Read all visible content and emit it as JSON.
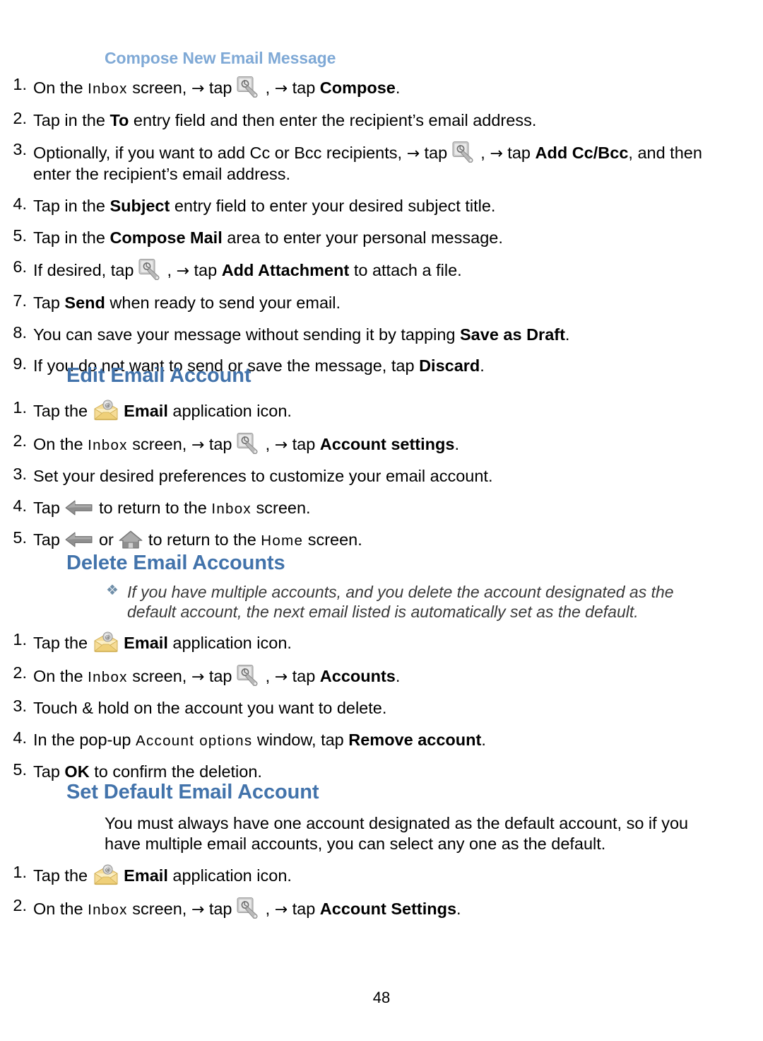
{
  "page": {
    "number": "48"
  },
  "sections": [
    {
      "id": "compose",
      "heading": "Compose New Email Message",
      "heading_level": "sub",
      "steps": [
        {
          "n": "1.",
          "parts": [
            {
              "t": "On the ",
              "s": "plain"
            },
            {
              "t": "Inbox",
              "s": "screen"
            },
            {
              "t": " screen, ",
              "s": "plain"
            },
            {
              "t": "→",
              "s": "arrow"
            },
            {
              "t": " tap ",
              "s": "plain"
            },
            {
              "t": "settings-wrench-icon",
              "s": "icon"
            },
            {
              "t": ", ",
              "s": "plain"
            },
            {
              "t": "→",
              "s": "arrow"
            },
            {
              "t": " tap ",
              "s": "plain"
            },
            {
              "t": "Compose",
              "s": "bold"
            },
            {
              "t": ".",
              "s": "plain"
            }
          ]
        },
        {
          "n": "2.",
          "parts": [
            {
              "t": "Tap in the ",
              "s": "plain"
            },
            {
              "t": "To",
              "s": "bold"
            },
            {
              "t": " entry field and then enter the recipient’s email address.",
              "s": "plain"
            }
          ]
        },
        {
          "n": "3.",
          "parts": [
            {
              "t": "Optionally, if you want to add Cc or Bcc recipients, ",
              "s": "plain"
            },
            {
              "t": "→",
              "s": "arrow"
            },
            {
              "t": " tap ",
              "s": "plain"
            },
            {
              "t": "settings-wrench-icon",
              "s": "icon"
            },
            {
              "t": ", ",
              "s": "plain"
            },
            {
              "t": "→",
              "s": "arrow"
            },
            {
              "t": " tap ",
              "s": "plain"
            },
            {
              "t": "Add Cc/Bcc",
              "s": "bold"
            },
            {
              "t": ", and then enter the recipient’s email address.",
              "s": "plain"
            }
          ]
        },
        {
          "n": "4.",
          "parts": [
            {
              "t": "Tap in the ",
              "s": "plain"
            },
            {
              "t": "Subject",
              "s": "bold"
            },
            {
              "t": " entry field to enter your desired subject title.",
              "s": "plain"
            }
          ]
        },
        {
          "n": "5.",
          "parts": [
            {
              "t": "Tap in the ",
              "s": "plain"
            },
            {
              "t": "Compose Mail",
              "s": "bold"
            },
            {
              "t": " area to enter your personal message.",
              "s": "plain"
            }
          ]
        },
        {
          "n": "6.",
          "parts": [
            {
              "t": "If desired, tap ",
              "s": "plain"
            },
            {
              "t": "settings-wrench-icon",
              "s": "icon"
            },
            {
              "t": ", ",
              "s": "plain"
            },
            {
              "t": "→",
              "s": "arrow"
            },
            {
              "t": " tap ",
              "s": "plain"
            },
            {
              "t": "Add Attachment",
              "s": "bold"
            },
            {
              "t": " to attach a file.",
              "s": "plain"
            }
          ]
        },
        {
          "n": "7.",
          "parts": [
            {
              "t": "Tap ",
              "s": "plain"
            },
            {
              "t": "Send",
              "s": "bold"
            },
            {
              "t": " when ready to send your email.",
              "s": "plain"
            }
          ]
        },
        {
          "n": "8.",
          "parts": [
            {
              "t": "You can save your message without sending it by tapping ",
              "s": "plain"
            },
            {
              "t": "Save as Draft",
              "s": "bold"
            },
            {
              "t": ".",
              "s": "plain"
            }
          ]
        },
        {
          "n": "9.",
          "parts": [
            {
              "t": "If you do not want to send or save the message, tap ",
              "s": "plain"
            },
            {
              "t": "Discard",
              "s": "bold"
            },
            {
              "t": ".",
              "s": "plain"
            }
          ]
        }
      ]
    },
    {
      "id": "edit-email-account",
      "heading": "Edit Email Account",
      "heading_level": "main",
      "steps": [
        {
          "n": "1.",
          "parts": [
            {
              "t": "Tap the ",
              "s": "plain"
            },
            {
              "t": "email-app-icon",
              "s": "icon"
            },
            {
              "t": " ",
              "s": "plain"
            },
            {
              "t": "Email",
              "s": "bold"
            },
            {
              "t": " application icon.",
              "s": "plain"
            }
          ]
        },
        {
          "n": "2.",
          "parts": [
            {
              "t": "On the ",
              "s": "plain"
            },
            {
              "t": "Inbox",
              "s": "screen"
            },
            {
              "t": " screen, ",
              "s": "plain"
            },
            {
              "t": "→",
              "s": "arrow"
            },
            {
              "t": " tap ",
              "s": "plain"
            },
            {
              "t": "settings-wrench-icon",
              "s": "icon"
            },
            {
              "t": ", ",
              "s": "plain"
            },
            {
              "t": "→",
              "s": "arrow"
            },
            {
              "t": " tap ",
              "s": "plain"
            },
            {
              "t": "Account settings",
              "s": "bold"
            },
            {
              "t": ".",
              "s": "plain"
            }
          ]
        },
        {
          "n": "3.",
          "parts": [
            {
              "t": "Set your desired preferences to customize your email account.",
              "s": "plain"
            }
          ]
        },
        {
          "n": "4.",
          "parts": [
            {
              "t": "Tap ",
              "s": "plain"
            },
            {
              "t": "back-arrow-icon",
              "s": "icon"
            },
            {
              "t": " to return to the ",
              "s": "plain"
            },
            {
              "t": "Inbox",
              "s": "screen"
            },
            {
              "t": " screen.",
              "s": "plain"
            }
          ]
        },
        {
          "n": "5.",
          "parts": [
            {
              "t": "Tap ",
              "s": "plain"
            },
            {
              "t": "back-arrow-icon",
              "s": "icon"
            },
            {
              "t": " or ",
              "s": "plain"
            },
            {
              "t": "home-icon",
              "s": "icon"
            },
            {
              "t": " to return to the ",
              "s": "plain"
            },
            {
              "t": "Home",
              "s": "screen"
            },
            {
              "t": " screen.",
              "s": "plain"
            }
          ]
        }
      ]
    },
    {
      "id": "delete-email-accounts",
      "heading": "Delete Email Accounts",
      "heading_level": "main",
      "note": "If you have multiple accounts, and you delete the account designated as the default account, the next email listed is automatically set as the default.",
      "note_bullet": "diamond-bullet-icon",
      "steps": [
        {
          "n": "1.",
          "parts": [
            {
              "t": "Tap the ",
              "s": "plain"
            },
            {
              "t": "email-app-icon",
              "s": "icon"
            },
            {
              "t": " ",
              "s": "plain"
            },
            {
              "t": "Email",
              "s": "bold"
            },
            {
              "t": " application icon.",
              "s": "plain"
            }
          ]
        },
        {
          "n": "2.",
          "parts": [
            {
              "t": "On the ",
              "s": "plain"
            },
            {
              "t": "Inbox",
              "s": "screen"
            },
            {
              "t": " screen, ",
              "s": "plain"
            },
            {
              "t": "→",
              "s": "arrow"
            },
            {
              "t": " tap ",
              "s": "plain"
            },
            {
              "t": "settings-wrench-icon",
              "s": "icon"
            },
            {
              "t": ", ",
              "s": "plain"
            },
            {
              "t": "→",
              "s": "arrow"
            },
            {
              "t": " tap ",
              "s": "plain"
            },
            {
              "t": "Accounts",
              "s": "bold"
            },
            {
              "t": ".",
              "s": "plain"
            }
          ]
        },
        {
          "n": "3.",
          "parts": [
            {
              "t": "Touch & hold on the account you want to delete.",
              "s": "plain"
            }
          ]
        },
        {
          "n": "4.",
          "parts": [
            {
              "t": "In the pop-up ",
              "s": "plain"
            },
            {
              "t": "Account options",
              "s": "screen"
            },
            {
              "t": " window, tap ",
              "s": "plain"
            },
            {
              "t": "Remove account",
              "s": "bold"
            },
            {
              "t": ".",
              "s": "plain"
            }
          ]
        },
        {
          "n": "5.",
          "parts": [
            {
              "t": "Tap ",
              "s": "plain"
            },
            {
              "t": "OK",
              "s": "bold"
            },
            {
              "t": " to confirm the deletion.",
              "s": "plain"
            }
          ]
        }
      ]
    },
    {
      "id": "set-default-email-account",
      "heading": "Set Default Email Account",
      "heading_level": "main",
      "paragraph": "You must always have one account designated as the default account, so if you have multiple email accounts, you can select any one as the default.",
      "steps": [
        {
          "n": "1.",
          "parts": [
            {
              "t": "Tap the ",
              "s": "plain"
            },
            {
              "t": "email-app-icon",
              "s": "icon"
            },
            {
              "t": " ",
              "s": "plain"
            },
            {
              "t": "Email",
              "s": "bold"
            },
            {
              "t": " application icon.",
              "s": "plain"
            }
          ]
        },
        {
          "n": "2.",
          "parts": [
            {
              "t": "On the ",
              "s": "plain"
            },
            {
              "t": "Inbox",
              "s": "screen"
            },
            {
              "t": " screen, ",
              "s": "plain"
            },
            {
              "t": "→",
              "s": "arrow"
            },
            {
              "t": " tap ",
              "s": "plain"
            },
            {
              "t": "settings-wrench-icon",
              "s": "icon"
            },
            {
              "t": ", ",
              "s": "plain"
            },
            {
              "t": "→",
              "s": "arrow"
            },
            {
              "t": " tap ",
              "s": "plain"
            },
            {
              "t": "Account Settings",
              "s": "bold"
            },
            {
              "t": ".",
              "s": "plain"
            }
          ]
        }
      ]
    }
  ],
  "colors": {
    "main_heading": "#4273ab",
    "sub_heading": "#7fa9d6",
    "body_text": "#000000",
    "note_text": "#3a3a3a",
    "icon_gray": "#8d8d8d",
    "envelope_yellow": "#f2d68a"
  }
}
